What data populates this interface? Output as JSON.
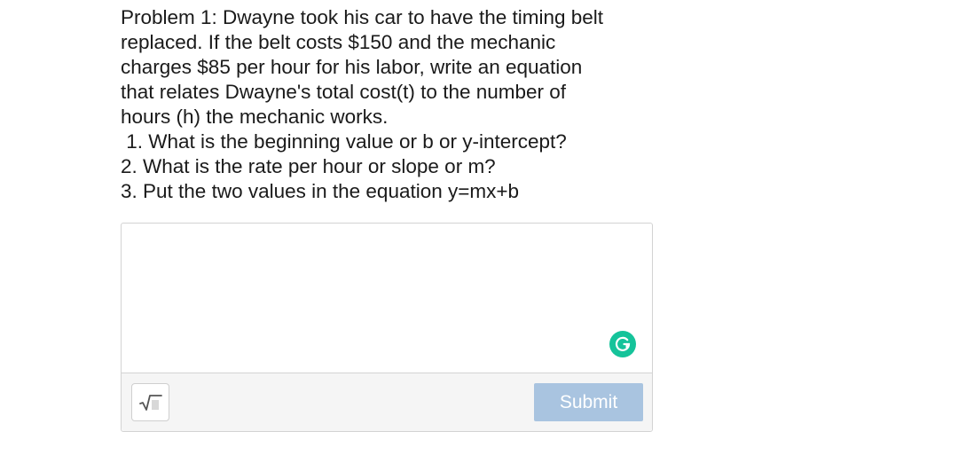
{
  "question": {
    "lines": [
      "Problem 1: Dwayne took his car to have the timing belt",
      "replaced. If the belt costs $150 and the mechanic",
      "charges $85 per hour for his labor, write an equation",
      "that relates Dwayne's total cost(t) to the number of",
      "hours (h) the mechanic works.",
      " 1. What is the beginning value or b or y-intercept?",
      "2. What is the rate per hour or slope or m?",
      "3. Put the two values in the equation y=mx+b"
    ]
  },
  "answer": {
    "value": "",
    "placeholder": ""
  },
  "toolbar": {
    "math_icon": "square-root-icon",
    "submit_label": "Submit"
  },
  "colors": {
    "submit_disabled": "#a9c4e0",
    "grammarly": "#15c39a",
    "toolbar_bg": "#f5f5f5",
    "border": "#d3d3d3"
  }
}
